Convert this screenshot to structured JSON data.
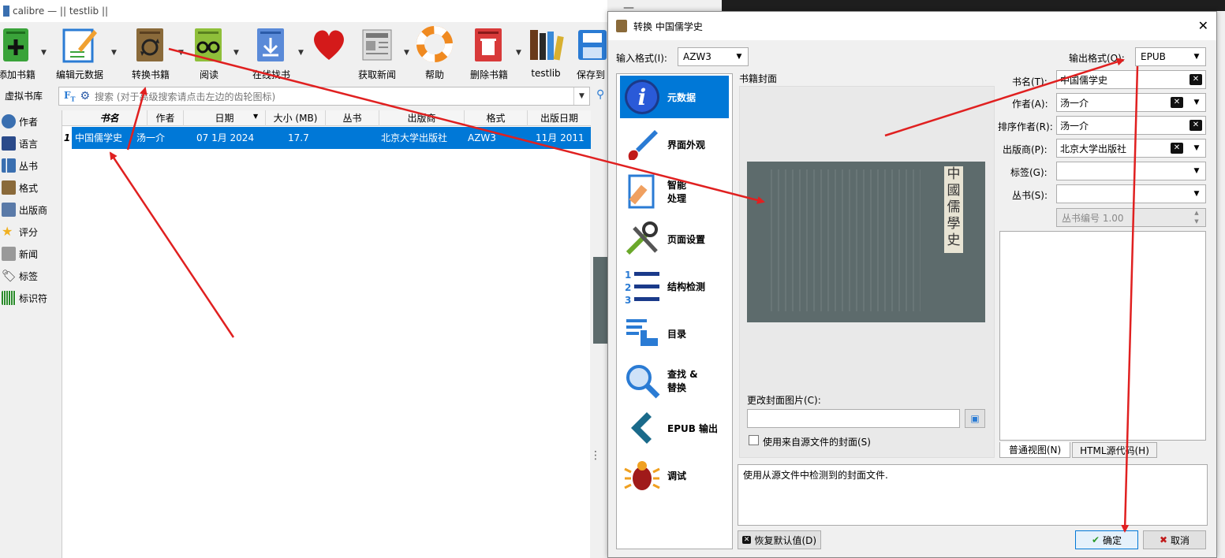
{
  "main_window": {
    "title": "calibre — || testlib ||",
    "toolbar": [
      {
        "label": "添加书籍",
        "icon": "add-book-icon"
      },
      {
        "label": "编辑元数据",
        "icon": "edit-metadata-icon"
      },
      {
        "label": "转换书籍",
        "icon": "convert-book-icon"
      },
      {
        "label": "阅读",
        "icon": "read-icon"
      },
      {
        "label": "在线找书",
        "icon": "download-icon"
      },
      {
        "label": "",
        "icon": "heart-icon"
      },
      {
        "label": "获取新闻",
        "icon": "news-icon"
      },
      {
        "label": "帮助",
        "icon": "help-icon"
      },
      {
        "label": "删除书籍",
        "icon": "delete-icon"
      },
      {
        "label": "testlib",
        "icon": "library-icon"
      },
      {
        "label": "保存到",
        "icon": "save-icon"
      }
    ],
    "virtual_library": "虚拟书库",
    "search_placeholder": "搜索 (对于高级搜索请点击左边的齿轮图标)",
    "sidebar": [
      "作者",
      "语言",
      "丛书",
      "格式",
      "出版商",
      "评分",
      "新闻",
      "标签",
      "标识符"
    ],
    "table": {
      "headers": [
        "书名",
        "作者",
        "日期",
        "大小 (MB)",
        "丛书",
        "出版商",
        "格式",
        "出版日期"
      ],
      "rows": [
        {
          "num": "1",
          "cells": [
            "中国儒学史",
            "汤一介",
            "07 1月 2024",
            "17.7",
            "",
            "北京大学出版社",
            "AZW3",
            "11月 2011"
          ]
        }
      ]
    }
  },
  "dialog": {
    "title": "转换 中国儒学史",
    "input_format_label": "输入格式(I):",
    "input_format_value": "AZW3",
    "output_format_label": "输出格式(O):",
    "output_format_value": "EPUB",
    "nav": [
      "元数据",
      "界面外观",
      "智能\n处理",
      "页面设置",
      "结构检测",
      "目录",
      "查找 &\n替换",
      "EPUB 输出",
      "调试"
    ],
    "cover_label": "书籍封面",
    "cover_text_1": "中國儒學史",
    "change_cover_label": "更改封面图片(C):",
    "use_source_cover_label": "使用来自源文件的封面(S)",
    "fields": {
      "title_label": "书名(T):",
      "title_value": "中国儒学史",
      "author_label": "作者(A):",
      "author_value": "汤一介",
      "author_sort_label": "排序作者(R):",
      "author_sort_value": "汤一介",
      "publisher_label": "出版商(P):",
      "publisher_value": "北京大学出版社",
      "tags_label": "标签(G):",
      "tags_value": "",
      "series_label": "丛书(S):",
      "series_value": "",
      "series_index": "丛书编号 1.00"
    },
    "tabs": [
      "普通视图(N)",
      "HTML源代码(H)"
    ],
    "help_text": "使用从源文件中检测到的封面文件.",
    "restore_defaults": "恢复默认值(D)",
    "ok": "确定",
    "cancel": "取消"
  },
  "colors": {
    "selection": "#0078d7",
    "arrow": "#e02020"
  }
}
